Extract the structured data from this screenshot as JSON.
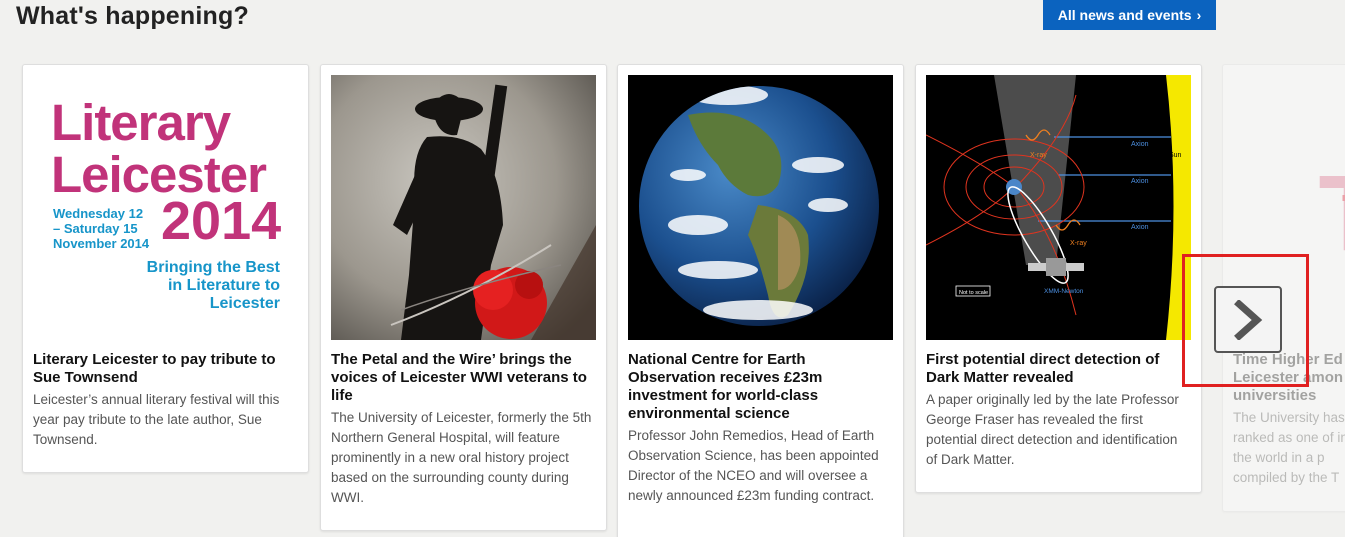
{
  "header": {
    "title": "What's happening?",
    "all_news_label": "All news and events",
    "all_news_chevron": "›"
  },
  "cards": [
    {
      "title": "Literary Leicester to pay tribute to Sue Townsend",
      "body": "Leicester’s annual literary festival will this year pay tribute to the late author, Sue Townsend.",
      "thumb": {
        "line1": "Literary",
        "line2": "Leicester",
        "dates1": "Wednesday 12",
        "dates2": "– Saturday 15",
        "dates3": "November 2014",
        "year": "2014",
        "tag1": "Bringing the Best",
        "tag2": "in Literature to",
        "tag3": "Leicester"
      }
    },
    {
      "title": "The Petal and the Wire’ brings the voices of Leicester WWI veterans to life",
      "body": "The University of Leicester, formerly the 5th Northern General Hospital, will feature prominently in a new oral history project based on the surrounding county during WWI."
    },
    {
      "title": "National Centre for Earth Observation receives £23m investment for world-class environmental science",
      "body": "Professor John Remedios, Head of Earth Observation Science, has been appointed Director of the NCEO and will oversee a newly announced £23m funding contract."
    },
    {
      "title": "First potential direct detection of Dark Matter revealed",
      "body": "A paper originally led by the late Professor George Fraser has revealed the first potential direct detection and identification of Dark Matter.",
      "thumb": {
        "axion1": "Axion",
        "axion2": "Axion",
        "axion3": "Axion",
        "xray1": "X-ray",
        "xray2": "X-ray",
        "sun": "Sun",
        "satellite": "XMM-Newton",
        "scale": "Not to scale"
      }
    },
    {
      "title": "Time Higher Ed Leicester amon universities",
      "body": "The University has ranked as one of in the world in a p compiled by the T",
      "thumb": {
        "logo": "TH"
      }
    }
  ],
  "colors": {
    "accent": "#0b63bf",
    "literary_pink": "#c1337a",
    "literary_blue": "#1795c9",
    "highlight": "#e02020"
  },
  "carousel": {
    "next_icon": "chevron-right-icon"
  }
}
